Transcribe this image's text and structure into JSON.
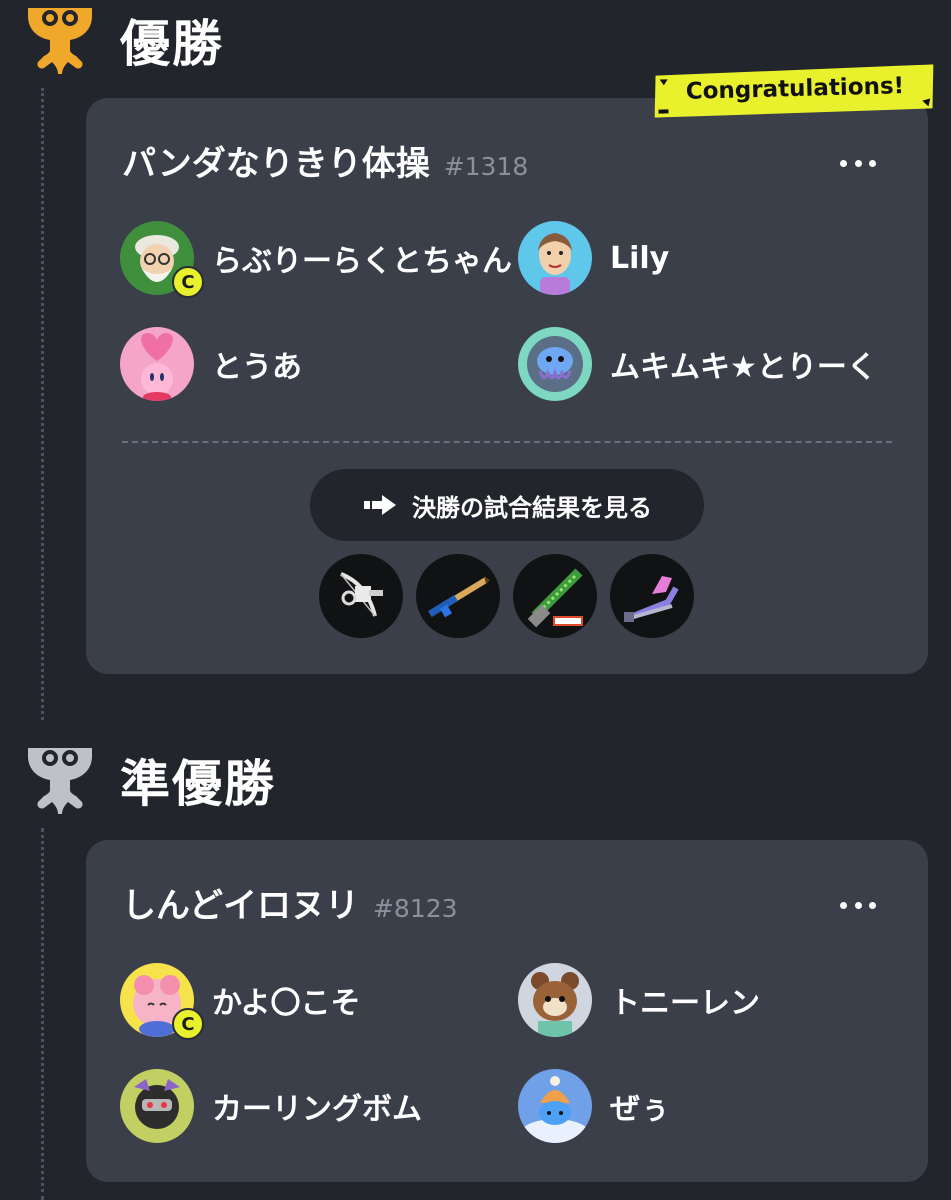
{
  "sections": [
    {
      "title": "優勝",
      "team": {
        "name": "パンダなりきり体操",
        "id": "#1318",
        "members": [
          {
            "name": "らぶりーらくとちゃん",
            "captain": true,
            "captain_label": "C",
            "avatar": "old-man-avatar"
          },
          {
            "name": "Lily",
            "captain": false,
            "avatar": "mii-avatar"
          },
          {
            "name": "とうあ",
            "captain": false,
            "avatar": "kirby-avatar"
          },
          {
            "name": "ムキムキ★とりーく",
            "captain": false,
            "avatar": "jellyfish-avatar"
          }
        ],
        "results_button": "決勝の試合結果を見る",
        "weapons": [
          "bow-weapon-icon",
          "brush-weapon-icon",
          "saw-weapon-icon",
          "splatana-weapon-icon"
        ]
      },
      "badge": "Congratulations!"
    },
    {
      "title": "準優勝",
      "team": {
        "name": "しんどイロヌリ",
        "id": "#8123",
        "members": [
          {
            "name": "かよ〇こそ",
            "captain": true,
            "captain_label": "C",
            "avatar": "pink-character-avatar"
          },
          {
            "name": "トニーレン",
            "captain": false,
            "avatar": "tanuki-avatar"
          },
          {
            "name": "カーリングボム",
            "captain": false,
            "avatar": "robot-avatar"
          },
          {
            "name": "ぜぅ",
            "captain": false,
            "avatar": "snow-character-avatar"
          }
        ]
      }
    }
  ],
  "colors": {
    "background": "#23252d",
    "card": "#3b3f4a",
    "gold": "#f0a82a",
    "silver": "#bfc1c6",
    "badge": "#e8f12b"
  }
}
